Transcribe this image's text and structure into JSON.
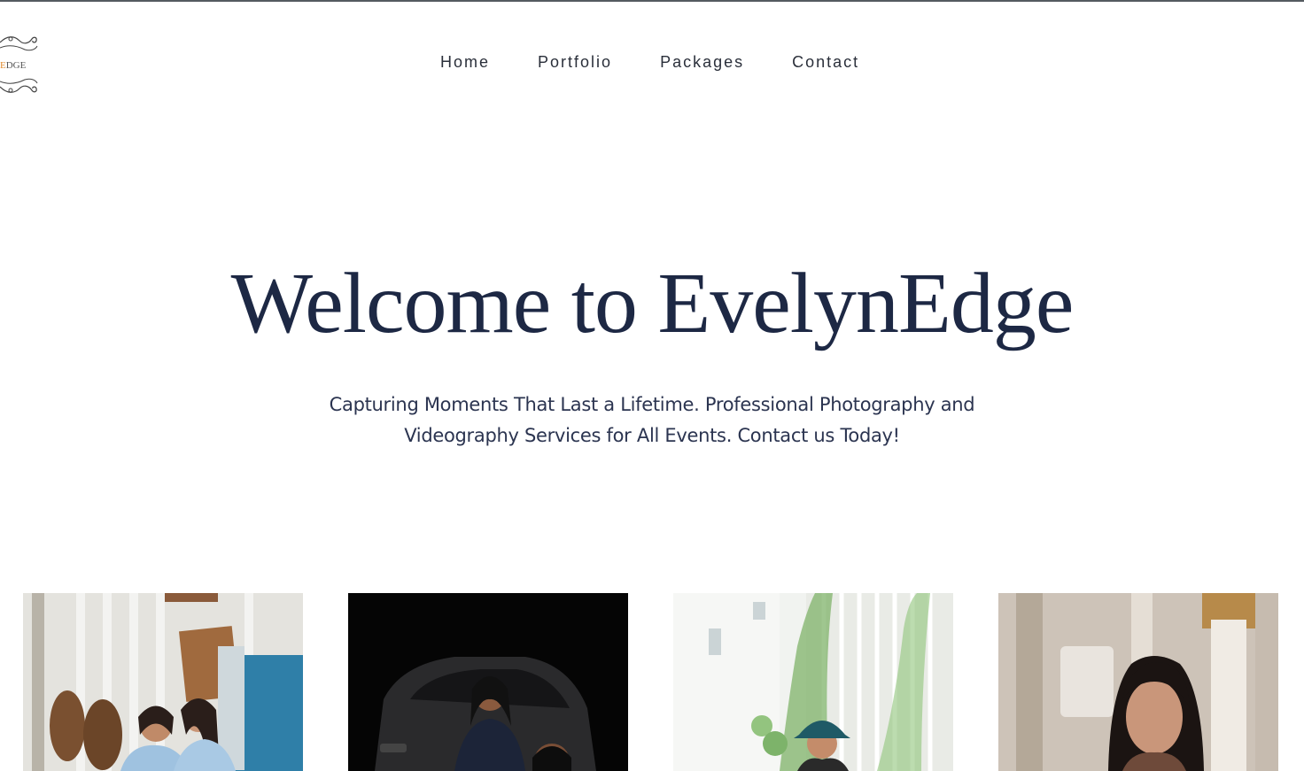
{
  "brand": {
    "logo_text_accent": "E",
    "logo_text_rest": "DGE",
    "accent_color": "#e08a2c"
  },
  "nav": {
    "items": [
      {
        "label": "Home"
      },
      {
        "label": "Portfolio"
      },
      {
        "label": "Packages"
      },
      {
        "label": "Contact"
      }
    ]
  },
  "hero": {
    "title": "Welcome to EvelynEdge",
    "subtitle_line1": "Capturing Moments That Last a Lifetime. Professional Photography and",
    "subtitle_line2": "Videography Services for All Events. Contact us Today!"
  },
  "gallery": {
    "items": [
      {
        "icon": "photo-two-women-blue-dresses"
      },
      {
        "icon": "photo-woman-with-car-dark"
      },
      {
        "icon": "photo-woman-bucket-hat-greenery"
      },
      {
        "icon": "photo-woman-portrait-indoor"
      }
    ]
  },
  "colors": {
    "title": "#1d2844",
    "text": "#2b3450",
    "top_border": "#555a60"
  }
}
